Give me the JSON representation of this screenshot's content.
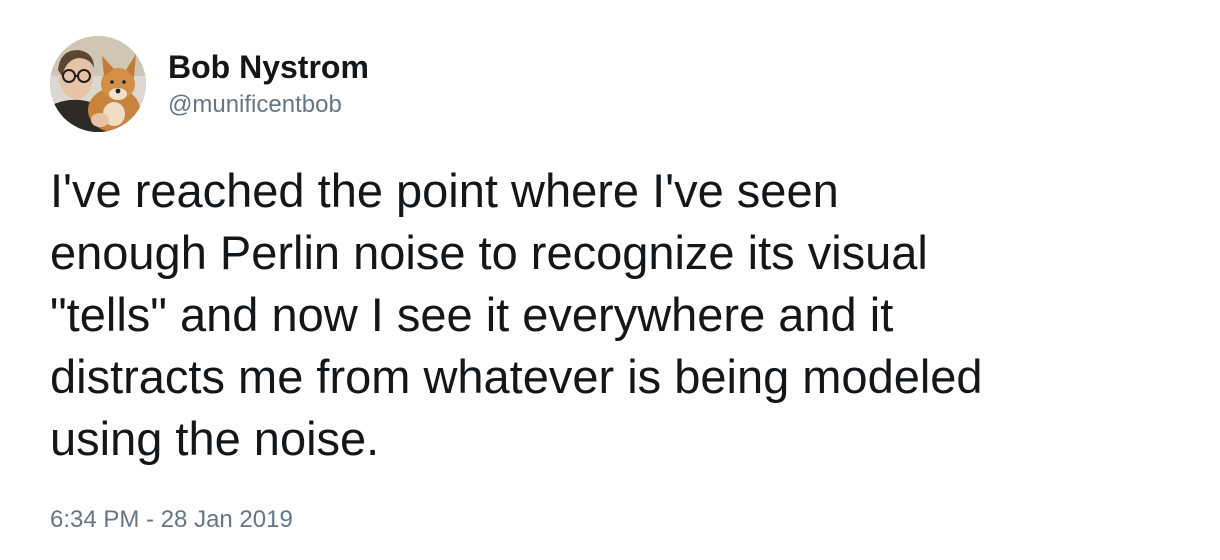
{
  "author": {
    "display_name": "Bob Nystrom",
    "handle": "@munificentbob",
    "avatar_icon": "user-avatar-with-dog"
  },
  "tweet": {
    "text": "I've reached the point where I've seen\nenough Perlin noise to recognize its visual\n\"tells\" and now I see it everywhere and it\ndistracts me from whatever is being modeled\nusing the noise.",
    "timestamp": "6:34 PM - 28 Jan 2019"
  },
  "colors": {
    "text": "#14171a",
    "secondary_text": "#657786",
    "background": "#ffffff"
  }
}
